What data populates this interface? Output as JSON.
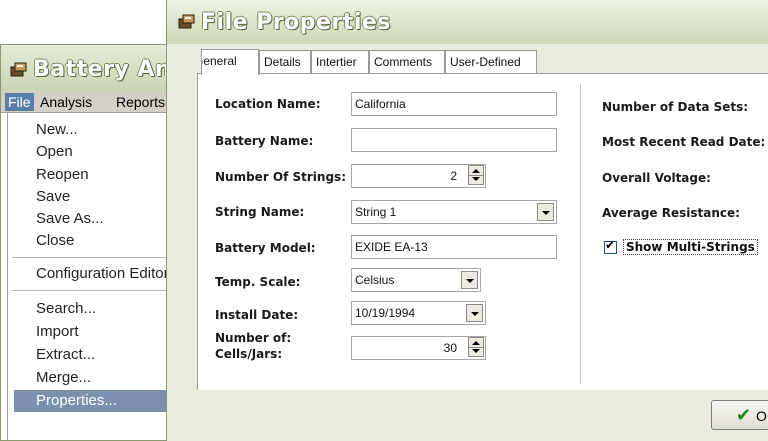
{
  "back_window": {
    "title": "Battery Analysis",
    "menubar": {
      "file": "File",
      "analysis": "Analysis",
      "reports": "Reports"
    },
    "file_menu": {
      "items": [
        "New...",
        "Open",
        "Reopen",
        "Save",
        "Save As...",
        "Close",
        "Configuration Editor",
        "Search...",
        "Import",
        "Extract...",
        "Merge...",
        "Properties..."
      ],
      "selected": "Properties..."
    }
  },
  "dialog": {
    "title": "File Properties",
    "tabs": [
      "General",
      "Details",
      "Intertier",
      "Comments",
      "User-Defined"
    ],
    "active_tab": "General",
    "fields": {
      "location_name": {
        "label": "Location Name:",
        "value": "California"
      },
      "battery_name": {
        "label": "Battery Name:",
        "value": ""
      },
      "number_of_strings": {
        "label": "Number Of Strings:",
        "value": "2"
      },
      "string_name": {
        "label": "String Name:",
        "value": "String 1"
      },
      "battery_model": {
        "label": "Battery Model:",
        "value": "EXIDE EA-13"
      },
      "temp_scale": {
        "label": "Temp. Scale:",
        "value": "Celsius"
      },
      "install_date": {
        "label": "Install Date:",
        "value": "10/19/1994"
      },
      "number_of_cells": {
        "label_line1": "Number of:",
        "label_line2": "Cells/Jars:",
        "value": "30"
      }
    },
    "summary": {
      "data_sets_label": "Number of Data Sets:",
      "recent_read_label": "Most Recent Read Date:",
      "overall_voltage_label": "Overall Voltage:",
      "average_resistance_label": "Average Resistance:",
      "show_multi_strings": {
        "label": "Show Multi-Strings",
        "checked": true
      }
    },
    "ok_button": "OK"
  },
  "colors": {
    "title_gradient_top": "#ecf1e2",
    "title_gradient_bottom": "#ccd8b6",
    "menu_selection": "#7b90ad",
    "ok_check": "#1b8a1b"
  },
  "icons": [
    "app-icon",
    "check-icon",
    "chevron-down-icon",
    "spin-up-icon",
    "spin-down-icon"
  ]
}
